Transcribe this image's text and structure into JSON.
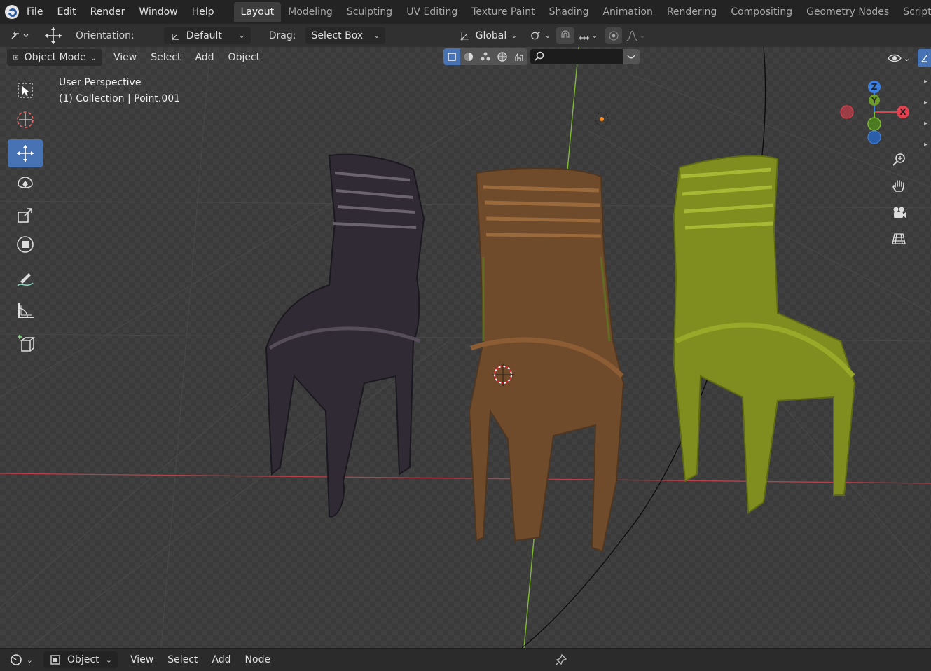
{
  "topbar": {
    "menus": [
      "File",
      "Edit",
      "Render",
      "Window",
      "Help"
    ],
    "workspaces": [
      "Layout",
      "Modeling",
      "Sculpting",
      "UV Editing",
      "Texture Paint",
      "Shading",
      "Animation",
      "Rendering",
      "Compositing",
      "Geometry Nodes",
      "Scripting"
    ],
    "active_workspace": "Layout"
  },
  "tool_header": {
    "orientation_label": "Orientation:",
    "orientation_value": "Default",
    "drag_label": "Drag:",
    "drag_value": "Select Box",
    "transform_orientation": "Global"
  },
  "viewport_header": {
    "mode": "Object Mode",
    "menus": [
      "View",
      "Select",
      "Add",
      "Object"
    ]
  },
  "viewport": {
    "perspective": "User Perspective",
    "info": "(1) Collection | Point.001",
    "axis_labels": {
      "x": "X",
      "y": "Y",
      "z": "Z"
    },
    "colors": {
      "x_axis": "#e2404f",
      "y_axis": "#7fba31",
      "z_axis": "#3d7fe0",
      "chair_dark": "#2f2a33",
      "chair_brown": "#7a5230",
      "chair_olive": "#7f8e1e"
    }
  },
  "toolbar": {
    "tools": [
      "select-box",
      "cursor",
      "move",
      "rotate",
      "scale",
      "transform",
      "annotate",
      "measure",
      "add-cube"
    ],
    "active_tool": "move"
  },
  "bottom_bar": {
    "editor_type": "Object",
    "menus": [
      "View",
      "Select",
      "Add",
      "Node"
    ]
  }
}
